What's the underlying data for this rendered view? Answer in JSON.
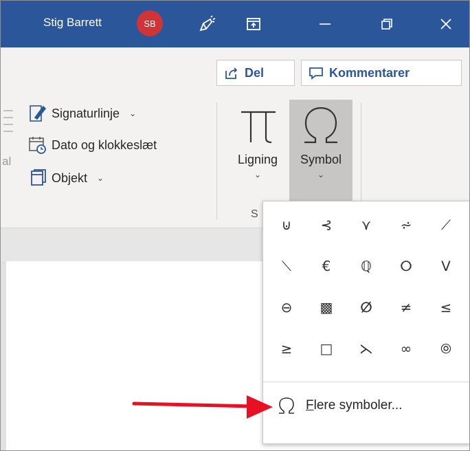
{
  "titlebar": {
    "user_name": "Stig Barrett",
    "avatar_initials": "SB",
    "bg_color": "#2b579a",
    "avatar_color": "#d13438",
    "icons": [
      "draw-icon",
      "ribbon-display-icon",
      "minimize-icon",
      "restore-icon",
      "close-icon"
    ]
  },
  "ribbon": {
    "share_label": "Del",
    "comments_label": "Kommentarer",
    "commands": {
      "signature_line": "Signaturlinje",
      "date_time": "Dato og klokkeslæt",
      "object": "Objekt"
    },
    "partial_left_text": "al",
    "equation_label": "Ligning",
    "symbol_label": "Symbol",
    "group_label_partial": "S"
  },
  "symbol_dropdown": {
    "symbols": [
      "⊍",
      "⊰",
      "⋎",
      "⩫",
      "⟋",
      "⟍",
      "€",
      "ℚ",
      "ⵔ",
      "ⴸ",
      "⊖",
      "▩",
      "ⵁ",
      "≠",
      "≤",
      "≥",
      "□",
      "⋋",
      "∞",
      "⦾"
    ],
    "more_symbols": {
      "icon": "omega-icon",
      "mnemonic": "F",
      "label_rest": "lere symboler..."
    }
  },
  "annotation": {
    "arrow_color": "#e81123"
  }
}
